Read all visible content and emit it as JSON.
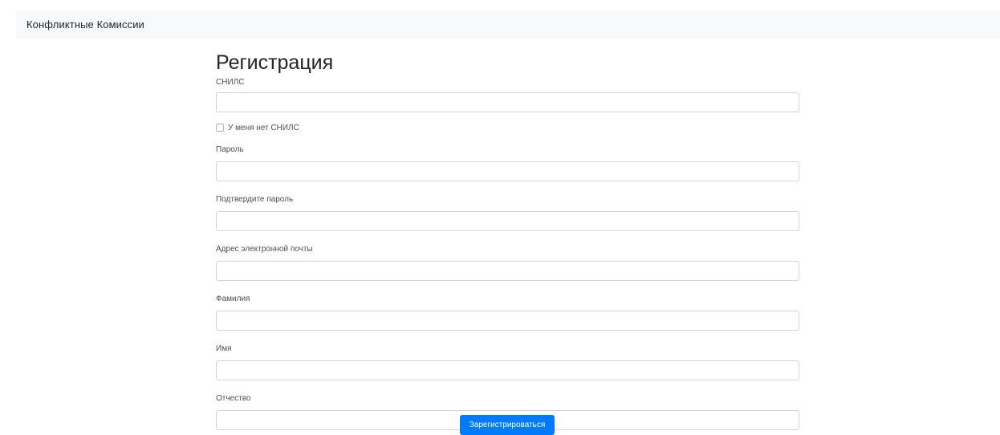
{
  "navbar": {
    "brand": "Конфликтные Комиссии"
  },
  "page": {
    "title": "Регистрация"
  },
  "form": {
    "snils": {
      "label": "СНИЛС",
      "value": "",
      "placeholder": ""
    },
    "no_snils": {
      "label": "У меня нет СНИЛС",
      "checked": false
    },
    "password": {
      "label": "Пароль",
      "value": "",
      "placeholder": ""
    },
    "confirm_password": {
      "label": "Подтвердите пароль",
      "value": "",
      "placeholder": ""
    },
    "email": {
      "label": "Адрес электронной почты",
      "value": "",
      "placeholder": ""
    },
    "last_name": {
      "label": "Фамилия",
      "value": "",
      "placeholder": ""
    },
    "first_name": {
      "label": "Имя",
      "value": "",
      "placeholder": ""
    },
    "middle_name": {
      "label": "Отчество",
      "value": "",
      "placeholder": ""
    },
    "submit_label": "Зарегистрироваться"
  },
  "colors": {
    "navbar_bg": "#f8f9fa",
    "primary": "#007bff",
    "input_border": "#ced4da"
  }
}
